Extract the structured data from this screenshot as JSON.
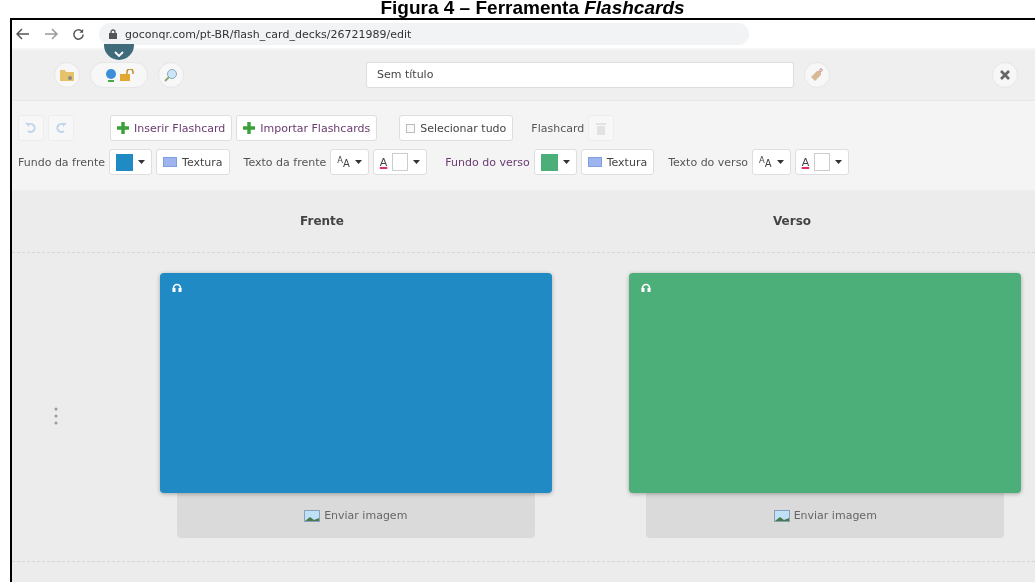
{
  "caption": "Figura 4 – Ferramenta *Flashcards*",
  "browser": {
    "url": "goconqr.com/pt-BR/flash_card_decks/26721989/edit"
  },
  "header": {
    "title_field": {
      "value": "Sem título"
    }
  },
  "toolbar": {
    "history": [
      {
        "kind": "undo",
        "disabled": true
      },
      {
        "kind": "redo",
        "disabled": true
      }
    ],
    "buttons": [
      {
        "label": "Inserir Flashcard",
        "kind": "add"
      },
      {
        "label": "Importar Flashcards",
        "kind": "add"
      },
      {
        "label": "Selecionar tudo",
        "kind": "check"
      }
    ],
    "flashcard_label": "Flashcard",
    "delete_button": {
      "disabled": true
    }
  },
  "sides": [
    {
      "background_label": "Fundo da frente",
      "texture_label": "Textura",
      "text_label": "Texto da frente",
      "font_size_glyph": "$^{A}$A",
      "text_color_glyph": "A",
      "heading": "Frente",
      "color": "#1f8ac4",
      "upload_label": "Enviar imagem"
    },
    {
      "background_label": "Fundo do verso",
      "texture_label": "Textura",
      "text_label": "Texto do verso",
      "font_size_glyph": "$^{A}$A",
      "text_color_glyph": "A",
      "heading": "Verso",
      "color": "#4caf7a",
      "upload_label": "Enviar imagem"
    }
  ]
}
